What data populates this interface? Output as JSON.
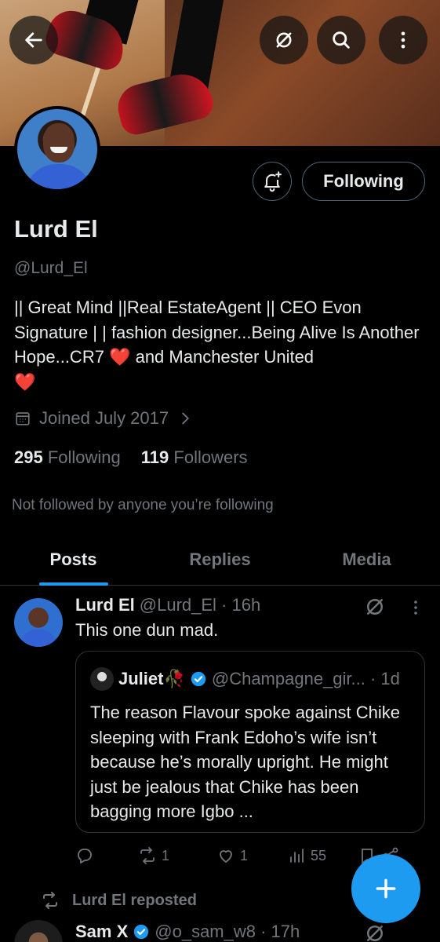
{
  "colors": {
    "accent": "#1d9bf0",
    "muted": "#71767b",
    "text": "#e7e9ea",
    "heart": "#f0283c",
    "background": "#000000"
  },
  "header": {
    "icons": [
      "back-arrow-icon",
      "grok-icon",
      "search-icon",
      "more-vertical-icon"
    ]
  },
  "profile": {
    "name": "Lurd El",
    "handle": "@Lurd_El",
    "follow_button": "Following",
    "bio_text": "|| Great Mind ||Real EstateAgent || CEO Evon Signature | | fashion designer...Being Alive Is Another Hope...CR7 ",
    "bio_text_2": " and Manchester United",
    "heart": "❤️",
    "joined": "Joined July 2017",
    "following_count": "295",
    "following_label": "Following",
    "followers_count": "119",
    "followers_label": "Followers",
    "not_followed": "Not followed by anyone you’re following"
  },
  "tabs": [
    {
      "label": "Posts",
      "active": true
    },
    {
      "label": "Replies",
      "active": false
    },
    {
      "label": "Media",
      "active": false
    }
  ],
  "post": {
    "author": "Lurd El",
    "handle_time": "@Lurd_El · 16h",
    "text": "This one dun mad.",
    "quote": {
      "author": "Juliet🥀",
      "handle_time": "@Champagne_gir... · 1d",
      "text": "The reason Flavour spoke against Chike sleeping with Frank Edoho’s wife isn’t because he’s morally upright. He might just be jealous that Chike has been bagging more Igbo ..."
    },
    "reposts": "1",
    "likes": "1",
    "views": "55"
  },
  "repost_note": "Lurd El reposted",
  "post2": {
    "author": "Sam X",
    "handle_time": "@o_sam_w8 · 17h"
  }
}
